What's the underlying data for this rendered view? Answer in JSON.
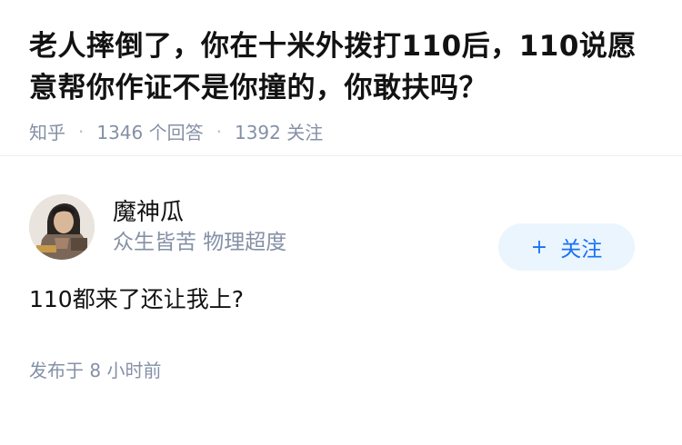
{
  "question": {
    "title": "老人摔倒了，你在十米外拨打110后，110说愿意帮你作证不是你撞的，你敢扶吗？",
    "source": "知乎",
    "answer_count": "1346 个回答",
    "follower_count": "1392 关注"
  },
  "answer": {
    "author": {
      "name": "魔神瓜",
      "bio": "众生皆苦 物理超度"
    },
    "follow_button": {
      "icon": "plus-icon",
      "label": "关注"
    },
    "content": "110都来了还让我上?",
    "published": "发布于 8 小时前"
  },
  "colors": {
    "accent": "#1772f6",
    "follow_bg": "#ebf5fd",
    "meta_text": "#8590a6"
  }
}
